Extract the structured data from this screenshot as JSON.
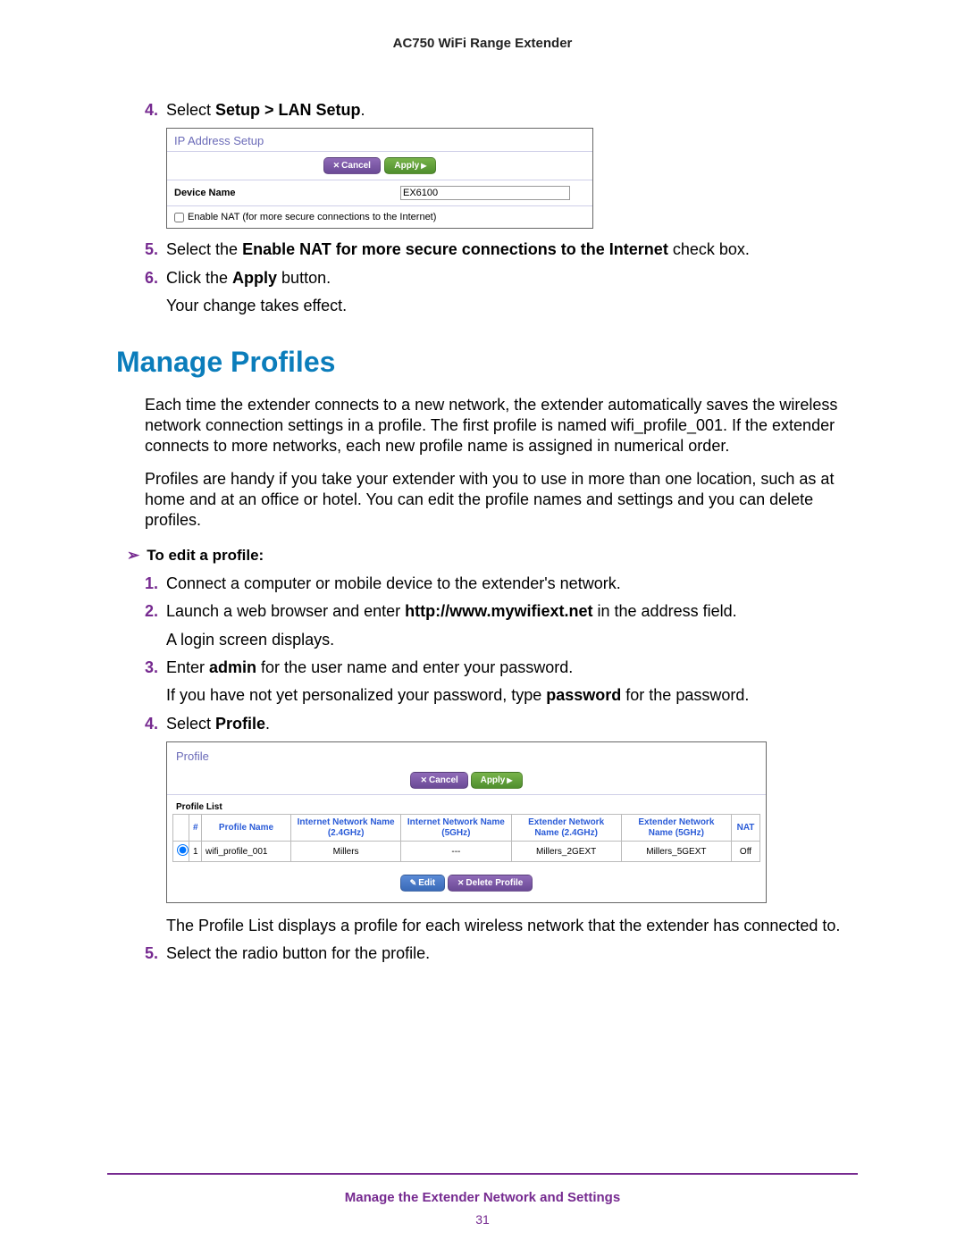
{
  "header": {
    "title": "AC750 WiFi Range Extender"
  },
  "step4": {
    "num": "4.",
    "pre": "Select ",
    "bold": "Setup > LAN Setup",
    "post": "."
  },
  "fig1": {
    "title": "IP Address Setup",
    "cancel": "Cancel",
    "apply": "Apply",
    "device_label": "Device Name",
    "device_value": "EX6100",
    "nat_label": "Enable NAT (for more secure connections to the Internet)"
  },
  "step5": {
    "num": "5.",
    "pre": "Select the ",
    "bold": "Enable NAT for more secure connections to the Internet",
    "post": " check box."
  },
  "step6": {
    "num": "6.",
    "pre": "Click the ",
    "bold": "Apply",
    "post": " button."
  },
  "step6_after": "Your change takes effect.",
  "section_heading": "Manage Profiles",
  "para1": "Each time the extender connects to a new network, the extender automatically saves the wireless network connection settings in a profile. The first profile is named wifi_profile_001. If the extender connects to more networks, each new profile name is assigned in numerical order.",
  "para2": "Profiles are handy if you take your extender with you to use in more than one location, such as at home and at an office or hotel. You can edit the profile names and settings and you can delete profiles.",
  "task_heading": "To edit a profile:",
  "t1": {
    "num": "1.",
    "text": "Connect a computer or mobile device to the extender's network."
  },
  "t2": {
    "num": "2.",
    "pre": "Launch a web browser and enter ",
    "bold": "http://www.mywifiext.net",
    "post": " in the address field."
  },
  "t2_after": "A login screen displays.",
  "t3": {
    "num": "3.",
    "pre": "Enter ",
    "bold": "admin",
    "post": " for the user name and enter your password."
  },
  "t3_after_pre": "If you have not yet personalized your password, type ",
  "t3_after_bold": "password",
  "t3_after_post": " for the password.",
  "t4": {
    "num": "4.",
    "pre": "Select ",
    "bold": "Profile",
    "post": "."
  },
  "fig2": {
    "title": "Profile",
    "cancel": "Cancel",
    "apply": "Apply",
    "sub": "Profile List",
    "headers": {
      "num": "#",
      "pname": "Profile Name",
      "in24": "Internet Network Name (2.4GHz)",
      "in5": "Internet Network Name (5GHz)",
      "ex24": "Extender Network Name (2.4GHz)",
      "ex5": "Extender Network Name (5GHz)",
      "nat": "NAT"
    },
    "row": {
      "num": "1",
      "pname": "wifi_profile_001",
      "in24": "Millers",
      "in5": "---",
      "ex24": "Millers_2GEXT",
      "ex5": "Millers_5GEXT",
      "nat": "Off"
    },
    "edit": "Edit",
    "delete": "Delete Profile"
  },
  "after_fig2": "The Profile List displays a profile for each wireless network that the extender has connected to.",
  "t5": {
    "num": "5.",
    "text": "Select the radio button for the profile."
  },
  "footer": {
    "chapter": "Manage the Extender Network and Settings",
    "page": "31"
  }
}
